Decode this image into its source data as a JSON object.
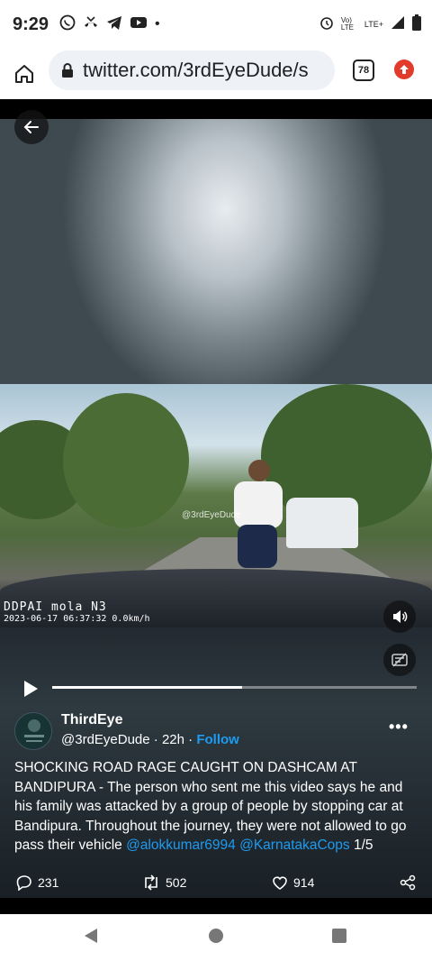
{
  "status_bar": {
    "time": "9:29",
    "dot": "•",
    "net_label": "Vo) LTE",
    "lte_label": "LTE+",
    "icons": [
      "whatsapp-icon",
      "missed-call-icon",
      "telegram-icon",
      "youtube-icon",
      "alarm-icon",
      "signal-icon",
      "battery-icon"
    ]
  },
  "browser": {
    "url": "twitter.com/3rdEyeDude/s",
    "tab_count": "78"
  },
  "video": {
    "watermark": "@3rdEyeDude",
    "osd_brand": "DDPAI mola N3",
    "osd_info": "2023-06-17   06:37:32   0.0km/h",
    "progress": 0.52
  },
  "tweet": {
    "author_name": "ThirdEye",
    "handle": "@3rdEyeDude",
    "separator": " · ",
    "time_ago": "22h",
    "follow_label": "Follow",
    "more": "•••",
    "text_main": "SHOCKING ROAD RAGE CAUGHT ON DASHCAM AT BANDIPURA - The person who sent me this video says he and his family was attacked by a group of people by stopping car at Bandipura. Throughout the journey, they were not allowed to go pass their vehicle ",
    "mention_1": "@alokkumar6994",
    "space": " ",
    "mention_2": "@KarnatakaCops",
    "suffix": " 1/5",
    "replies": "231",
    "retweets": "502",
    "likes": "914"
  },
  "colors": {
    "accent": "#1d9bf0",
    "update_badge": "#e33b2b"
  }
}
